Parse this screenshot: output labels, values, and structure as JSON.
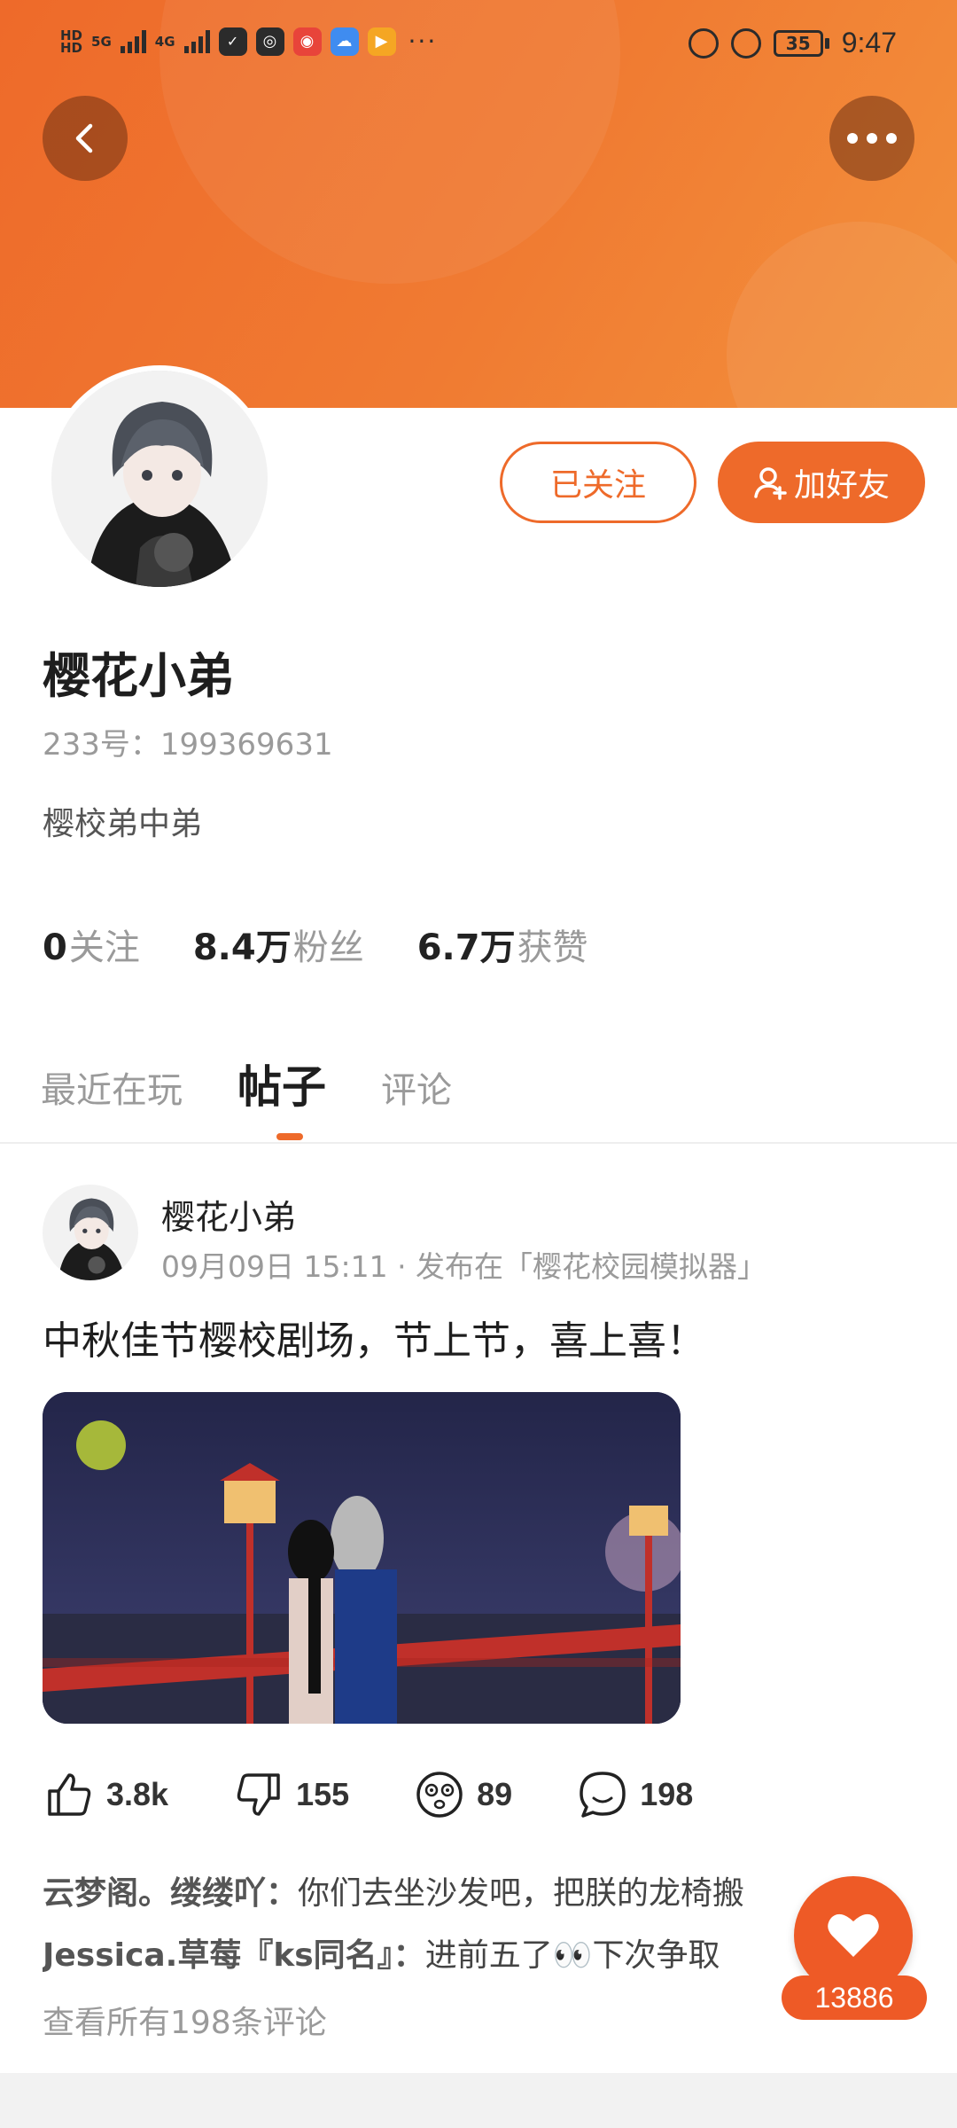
{
  "status_bar": {
    "network_left": "HD",
    "signal_1": "5G",
    "signal_2": "4G",
    "battery": "35",
    "time": "9:47"
  },
  "profile": {
    "name": "樱花小弟",
    "id_line": "233号：199369631",
    "bio": "樱校弟中弟",
    "follow_button": "已关注",
    "add_friend_button": "加好友"
  },
  "stats": [
    {
      "value": "0",
      "label": "关注"
    },
    {
      "value": "8.4万",
      "label": "粉丝"
    },
    {
      "value": "6.7万",
      "label": "获赞"
    }
  ],
  "tabs": [
    {
      "label": "最近在玩",
      "active": false
    },
    {
      "label": "帖子",
      "active": true
    },
    {
      "label": "评论",
      "active": false
    }
  ],
  "post": {
    "author": "樱花小弟",
    "meta": "09月09日 15:11 · 发布在「樱花校园模拟器」",
    "text": "中秋佳节樱校剧场，节上节，喜上喜！",
    "likes": "3.8k",
    "dislikes": "155",
    "reactions": "89",
    "comments": "198",
    "comment_previews": [
      {
        "name": "云梦阁。缕缕吖：",
        "text": "你们去坐沙发吧，把朕的龙椅搬"
      },
      {
        "name": "Jessica.草莓『ks同名』：",
        "text": "进前五了👀下次争取"
      }
    ],
    "view_all": "查看所有198条评论"
  },
  "fab": {
    "count": "13886"
  },
  "colors": {
    "accent": "#ee6a2a",
    "banner_start": "#ee6a2a",
    "banner_end": "#f3913c"
  }
}
